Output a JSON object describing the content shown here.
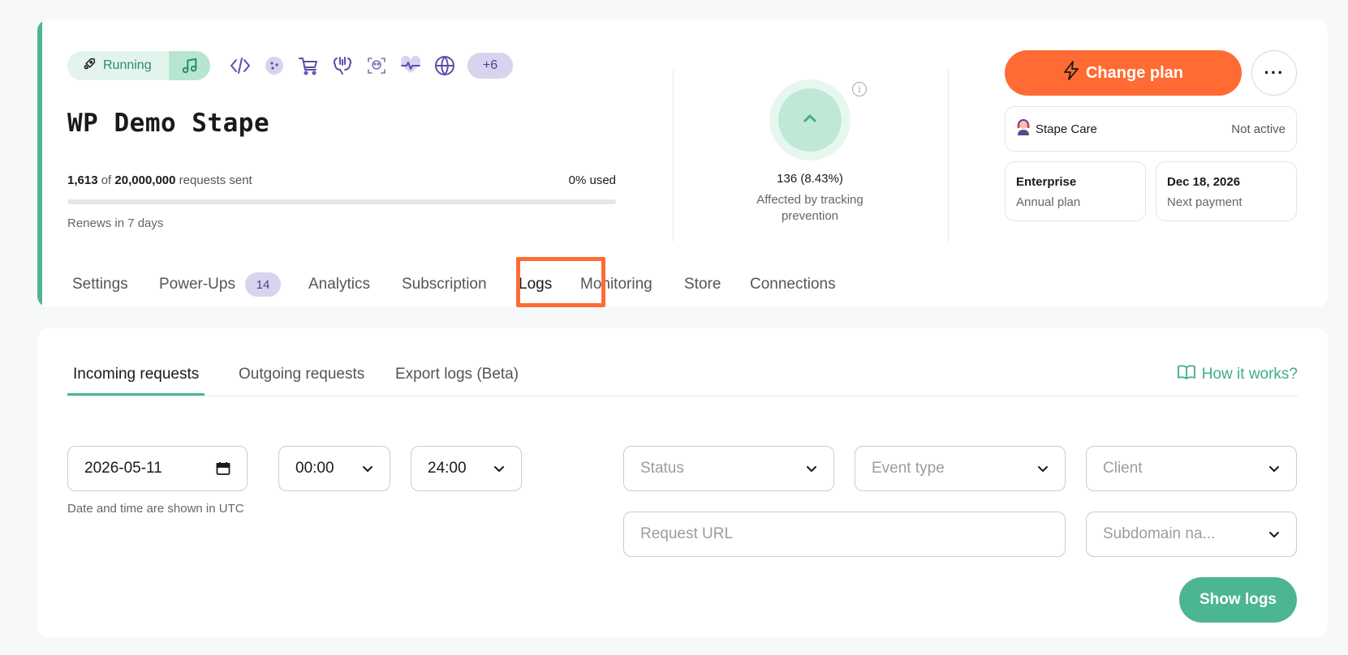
{
  "container": {
    "status": "Running",
    "more_badge": "+6",
    "name": "WP Demo Stape",
    "requests_sent": "1,613",
    "of_text": "of",
    "requests_limit": "20,000,000",
    "requests_suffix": "requests sent",
    "usage_percent_label": "0% used",
    "usage_fraction": 0.0001,
    "renews": "Renews in 7 days",
    "tool_icons": [
      "code-icon",
      "cookie-icon",
      "cart-icon",
      "brain-icon",
      "face-scan-icon",
      "heartbeat-icon",
      "globe-icon"
    ]
  },
  "tracking": {
    "count": "136 (8.43%)",
    "label": "Affected by tracking prevention"
  },
  "plan": {
    "change_plan_label": "Change plan",
    "more_label": "···",
    "care_label": "Stape Care",
    "care_state": "Not active",
    "plan_name": "Enterprise",
    "plan_period": "Annual plan",
    "next_payment_date": "Dec 18, 2026",
    "next_payment_label": "Next payment"
  },
  "main_tabs": [
    {
      "label": "Settings"
    },
    {
      "label": "Power-Ups",
      "badge": "14"
    },
    {
      "label": "Analytics"
    },
    {
      "label": "Subscription"
    },
    {
      "label": "Logs",
      "active": true
    },
    {
      "label": "Monitoring"
    },
    {
      "label": "Store"
    },
    {
      "label": "Connections"
    }
  ],
  "logs": {
    "tabs": [
      "Incoming requests",
      "Outgoing requests",
      "Export logs (Beta)"
    ],
    "how_it_works": "How it works?",
    "date": "2026-05-11",
    "time_from": "00:00",
    "time_to": "24:00",
    "utc_note": "Date and time are shown in UTC",
    "status_placeholder": "Status",
    "event_type_placeholder": "Event type",
    "client_placeholder": "Client",
    "request_url_placeholder": "Request URL",
    "subdomain_placeholder": "Subdomain na...",
    "show_logs_label": "Show logs"
  },
  "colors": {
    "accent_green": "#4cb591",
    "brand_orange": "#ff6b33",
    "badge_purple": "#d8d3ee",
    "icon_purple": "#5a4fa8"
  }
}
